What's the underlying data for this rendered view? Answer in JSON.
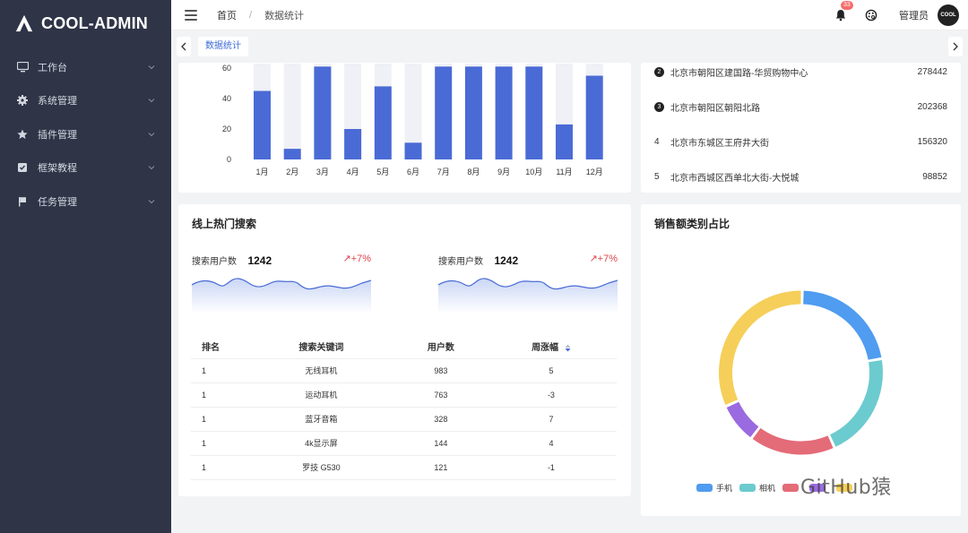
{
  "app": {
    "title": "COOL-ADMIN"
  },
  "sidebar": {
    "items": [
      {
        "label": "工作台",
        "icon": "monitor-icon"
      },
      {
        "label": "系统管理",
        "icon": "gear-icon"
      },
      {
        "label": "插件管理",
        "icon": "star-icon"
      },
      {
        "label": "框架教程",
        "icon": "book-icon"
      },
      {
        "label": "任务管理",
        "icon": "flag-icon"
      }
    ]
  },
  "header": {
    "breadcrumb": [
      "首页",
      "数据统计"
    ],
    "badge": "33",
    "username": "管理员",
    "avatar_text": "COOL"
  },
  "tabs": [
    "数据统计"
  ],
  "monthly_chart": {
    "chart_data": {
      "type": "bar",
      "categories": [
        "1月",
        "2月",
        "3月",
        "4月",
        "5月",
        "6月",
        "7月",
        "8月",
        "9月",
        "10月",
        "11月",
        "12月"
      ],
      "series": [
        {
          "values": [
            45,
            7,
            61,
            20,
            48,
            11,
            61,
            61,
            61,
            61,
            23,
            55
          ]
        }
      ],
      "y_ticks": [
        0,
        20,
        40,
        60
      ],
      "ylim": [
        0,
        63
      ],
      "colors": {
        "bar": "#4a6bd6",
        "background_bar": "#f0f1f6"
      }
    }
  },
  "store_ranking": [
    {
      "rank": "2",
      "name": "北京市朝阳区建国路-华贸购物中心",
      "value": "278442"
    },
    {
      "rank": "3",
      "name": "北京市朝阳区朝阳北路",
      "value": "202368"
    },
    {
      "rank": "4",
      "name": "北京市东城区王府井大街",
      "value": "156320"
    },
    {
      "rank": "5",
      "name": "北京市西城区西单北大街-大悦城",
      "value": "98852"
    }
  ],
  "hot_search": {
    "title": "线上热门搜索",
    "stats": [
      {
        "label": "搜索用户数",
        "value": "1242",
        "trend": "↗+7%"
      },
      {
        "label": "搜索用户数",
        "value": "1242",
        "trend": "↗+7%"
      }
    ],
    "table": {
      "headers": [
        "排名",
        "搜索关键词",
        "用户数",
        "周涨幅"
      ],
      "rows": [
        [
          "1",
          "无线耳机",
          "983",
          "5"
        ],
        [
          "1",
          "运动耳机",
          "763",
          "-3"
        ],
        [
          "1",
          "蓝牙音箱",
          "328",
          "7"
        ],
        [
          "1",
          "4k显示屏",
          "144",
          "4"
        ],
        [
          "1",
          "罗技 G530",
          "121",
          "-1"
        ]
      ]
    }
  },
  "sales_category": {
    "title": "销售额类别占比",
    "chart_data": {
      "type": "pie",
      "donut": true,
      "categories": [
        "手机",
        "相机",
        "",
        "",
        ""
      ],
      "values": [
        22,
        21,
        17,
        8,
        32
      ],
      "colors": [
        "#4f9cf0",
        "#6ccbcf",
        "#e46b78",
        "#9a6ae0",
        "#f5cf5a"
      ]
    },
    "legend_visible": [
      "手机",
      "相机"
    ]
  },
  "watermark": "GitHub猿"
}
